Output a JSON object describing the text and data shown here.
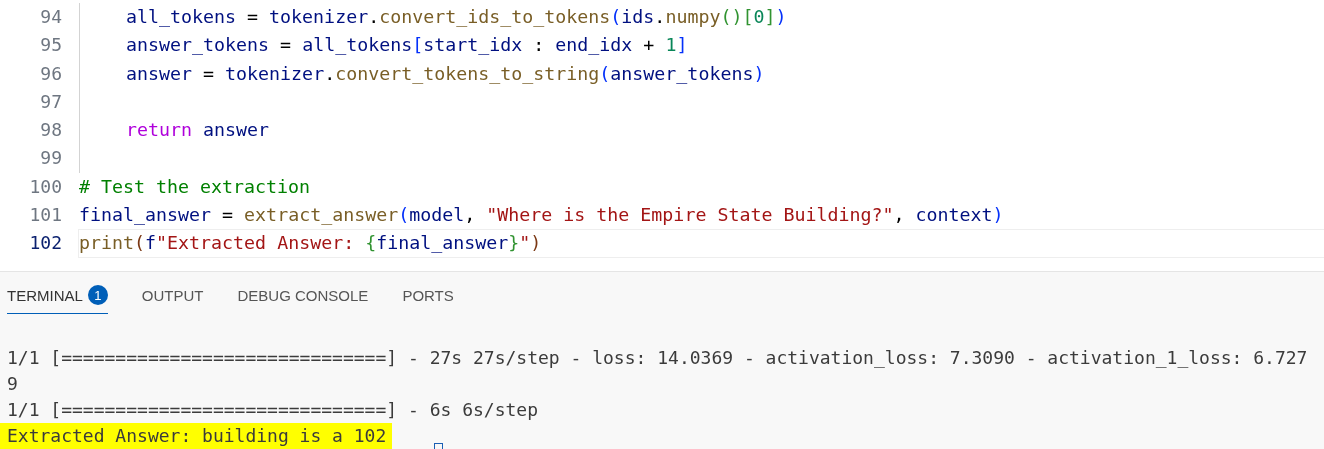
{
  "editor": {
    "lines": [
      {
        "number": "94",
        "current": false,
        "indented": true,
        "tokens": [
          {
            "kind": "var",
            "text": "all_tokens"
          },
          {
            "kind": "op",
            "text": " = "
          },
          {
            "kind": "var",
            "text": "tokenizer"
          },
          {
            "kind": "op",
            "text": "."
          },
          {
            "kind": "func",
            "text": "convert_ids_to_tokens"
          },
          {
            "kind": "bracket1",
            "text": "("
          },
          {
            "kind": "var",
            "text": "ids"
          },
          {
            "kind": "op",
            "text": "."
          },
          {
            "kind": "func",
            "text": "numpy"
          },
          {
            "kind": "bracket2",
            "text": "()["
          },
          {
            "kind": "number",
            "text": "0"
          },
          {
            "kind": "bracket2",
            "text": "]"
          },
          {
            "kind": "bracket1",
            "text": ")"
          }
        ]
      },
      {
        "number": "95",
        "current": false,
        "indented": true,
        "tokens": [
          {
            "kind": "var",
            "text": "answer_tokens"
          },
          {
            "kind": "op",
            "text": " = "
          },
          {
            "kind": "var",
            "text": "all_tokens"
          },
          {
            "kind": "bracket1",
            "text": "["
          },
          {
            "kind": "var",
            "text": "start_idx"
          },
          {
            "kind": "op",
            "text": " : "
          },
          {
            "kind": "var",
            "text": "end_idx"
          },
          {
            "kind": "op",
            "text": " + "
          },
          {
            "kind": "number",
            "text": "1"
          },
          {
            "kind": "bracket1",
            "text": "]"
          }
        ]
      },
      {
        "number": "96",
        "current": false,
        "indented": true,
        "tokens": [
          {
            "kind": "var",
            "text": "answer"
          },
          {
            "kind": "op",
            "text": " = "
          },
          {
            "kind": "var",
            "text": "tokenizer"
          },
          {
            "kind": "op",
            "text": "."
          },
          {
            "kind": "func",
            "text": "convert_tokens_to_string"
          },
          {
            "kind": "bracket1",
            "text": "("
          },
          {
            "kind": "var",
            "text": "answer_tokens"
          },
          {
            "kind": "bracket1",
            "text": ")"
          }
        ]
      },
      {
        "number": "97",
        "current": false,
        "indented": true
      },
      {
        "number": "98",
        "current": false,
        "indented": true,
        "tokens": [
          {
            "kind": "keyword",
            "text": "return"
          },
          {
            "kind": "var",
            "text": " answer"
          }
        ]
      },
      {
        "number": "99",
        "current": false,
        "indented": true
      },
      {
        "number": "100",
        "current": false,
        "indented": false,
        "tokens": [
          {
            "kind": "comment",
            "text": "# Test the extraction"
          }
        ]
      },
      {
        "number": "101",
        "current": false,
        "indented": false,
        "tokens": [
          {
            "kind": "var",
            "text": "final_answer"
          },
          {
            "kind": "op",
            "text": " = "
          },
          {
            "kind": "func",
            "text": "extract_answer"
          },
          {
            "kind": "bracket1",
            "text": "("
          },
          {
            "kind": "var",
            "text": "model"
          },
          {
            "kind": "op",
            "text": ", "
          },
          {
            "kind": "string",
            "text": "\"Where is the Empire State Building?\""
          },
          {
            "kind": "op",
            "text": ", "
          },
          {
            "kind": "var",
            "text": "context"
          },
          {
            "kind": "bracket1",
            "text": ")"
          }
        ]
      },
      {
        "number": "102",
        "current": true,
        "indented": false,
        "tokens": [
          {
            "kind": "func",
            "text": "print"
          },
          {
            "kind": "bracket3",
            "text": "("
          },
          {
            "kind": "var",
            "text": "f"
          },
          {
            "kind": "string",
            "text": "\"Extracted Answer: "
          },
          {
            "kind": "bracket2",
            "text": "{"
          },
          {
            "kind": "var",
            "text": "final_answer"
          },
          {
            "kind": "bracket2",
            "text": "}"
          },
          {
            "kind": "string",
            "text": "\""
          },
          {
            "kind": "bracket3",
            "text": ")"
          }
        ]
      }
    ]
  },
  "panel": {
    "tabs": [
      {
        "label": "TERMINAL",
        "selected": true,
        "badge": "1"
      },
      {
        "label": "OUTPUT",
        "selected": false
      },
      {
        "label": "DEBUG CONSOLE",
        "selected": false
      },
      {
        "label": "PORTS",
        "selected": false
      }
    ],
    "terminal_lines": [
      {
        "text": "1/1 [==============================] - 27s 27s/step - loss: 14.0369 - activation_loss: 7.3090 - activation_1_loss: 6.727",
        "highlighted": false
      },
      {
        "text": "9",
        "highlighted": false
      },
      {
        "text": "1/1 [==============================] - 6s 6s/step",
        "highlighted": false
      },
      {
        "text": "Extracted Answer: building is a 102",
        "highlighted": true
      }
    ]
  }
}
